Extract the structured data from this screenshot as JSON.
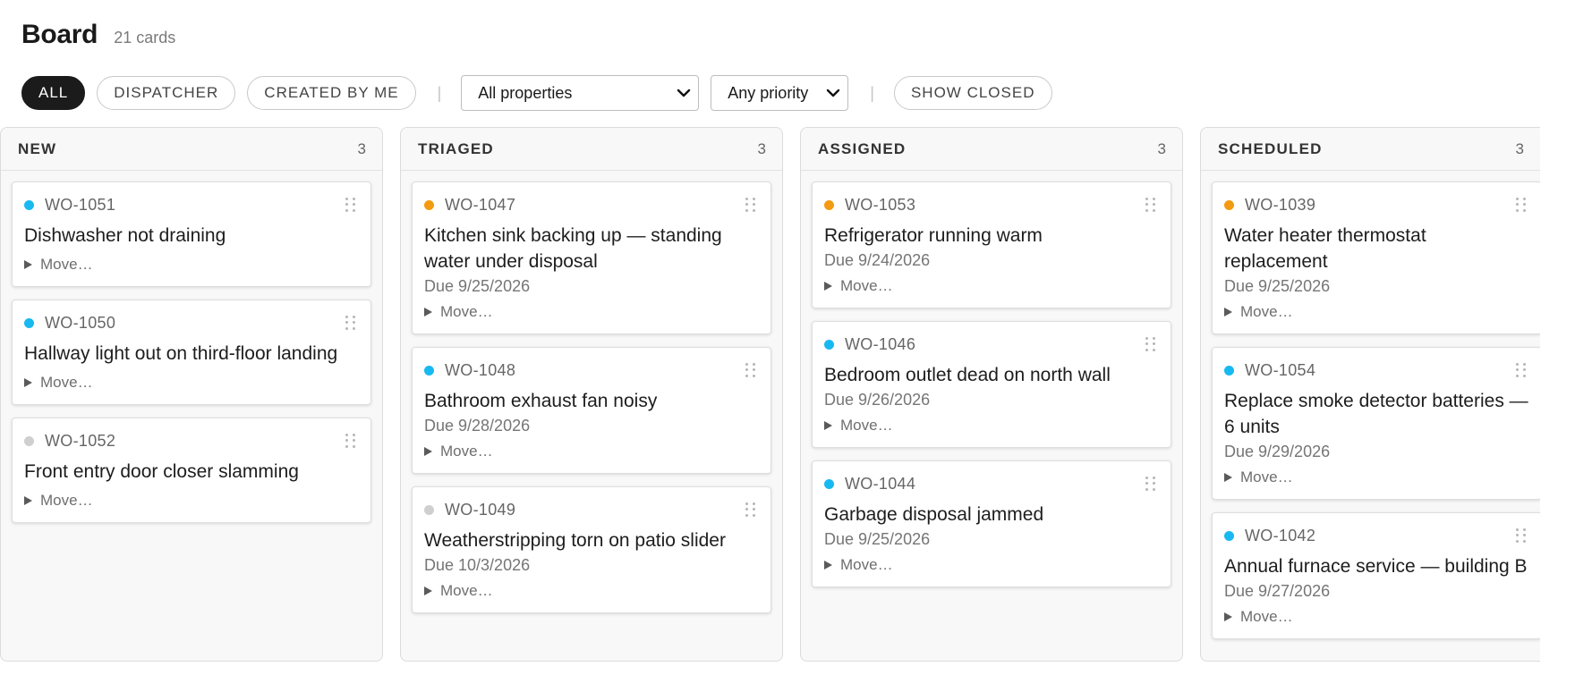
{
  "header": {
    "title": "Board",
    "count": "21 cards"
  },
  "filters": {
    "pills": [
      {
        "label": "ALL",
        "active": true
      },
      {
        "label": "DISPATCHER",
        "active": false
      },
      {
        "label": "CREATED BY ME",
        "active": false
      }
    ],
    "separator": "|",
    "property_select": "All properties",
    "priority_select": "Any priority",
    "show_closed": "SHOW CLOSED"
  },
  "colors": {
    "priority_high": "#f39a11",
    "priority_normal": "#18b9f0",
    "priority_low": "#cfcfcf",
    "active_pill": "#1b1b1b"
  },
  "move_label": "Move…",
  "columns": [
    {
      "title": "NEW",
      "count": "3",
      "cards": [
        {
          "id": "WO-1051",
          "priority": "normal",
          "title": "Dishwasher not draining",
          "due": ""
        },
        {
          "id": "WO-1050",
          "priority": "normal",
          "title": "Hallway light out on third-floor landing",
          "due": ""
        },
        {
          "id": "WO-1052",
          "priority": "low",
          "title": "Front entry door closer slamming",
          "due": ""
        }
      ]
    },
    {
      "title": "TRIAGED",
      "count": "3",
      "cards": [
        {
          "id": "WO-1047",
          "priority": "high",
          "title": "Kitchen sink backing up — standing water under disposal",
          "due": "Due 9/25/2026"
        },
        {
          "id": "WO-1048",
          "priority": "normal",
          "title": "Bathroom exhaust fan noisy",
          "due": "Due 9/28/2026"
        },
        {
          "id": "WO-1049",
          "priority": "low",
          "title": "Weatherstripping torn on patio slider",
          "due": "Due 10/3/2026"
        }
      ]
    },
    {
      "title": "ASSIGNED",
      "count": "3",
      "cards": [
        {
          "id": "WO-1053",
          "priority": "high",
          "title": "Refrigerator running warm",
          "due": "Due 9/24/2026"
        },
        {
          "id": "WO-1046",
          "priority": "normal",
          "title": "Bedroom outlet dead on north wall",
          "due": "Due 9/26/2026"
        },
        {
          "id": "WO-1044",
          "priority": "normal",
          "title": "Garbage disposal jammed",
          "due": "Due 9/25/2026"
        }
      ]
    },
    {
      "title": "SCHEDULED",
      "count": "3",
      "cards": [
        {
          "id": "WO-1039",
          "priority": "high",
          "title": "Water heater thermostat replacement",
          "due": "Due 9/25/2026"
        },
        {
          "id": "WO-1054",
          "priority": "normal",
          "title": "Replace smoke detector batteries — 6 units",
          "due": "Due 9/29/2026"
        },
        {
          "id": "WO-1042",
          "priority": "normal",
          "title": "Annual furnace service — building B",
          "due": "Due 9/27/2026"
        }
      ]
    }
  ]
}
